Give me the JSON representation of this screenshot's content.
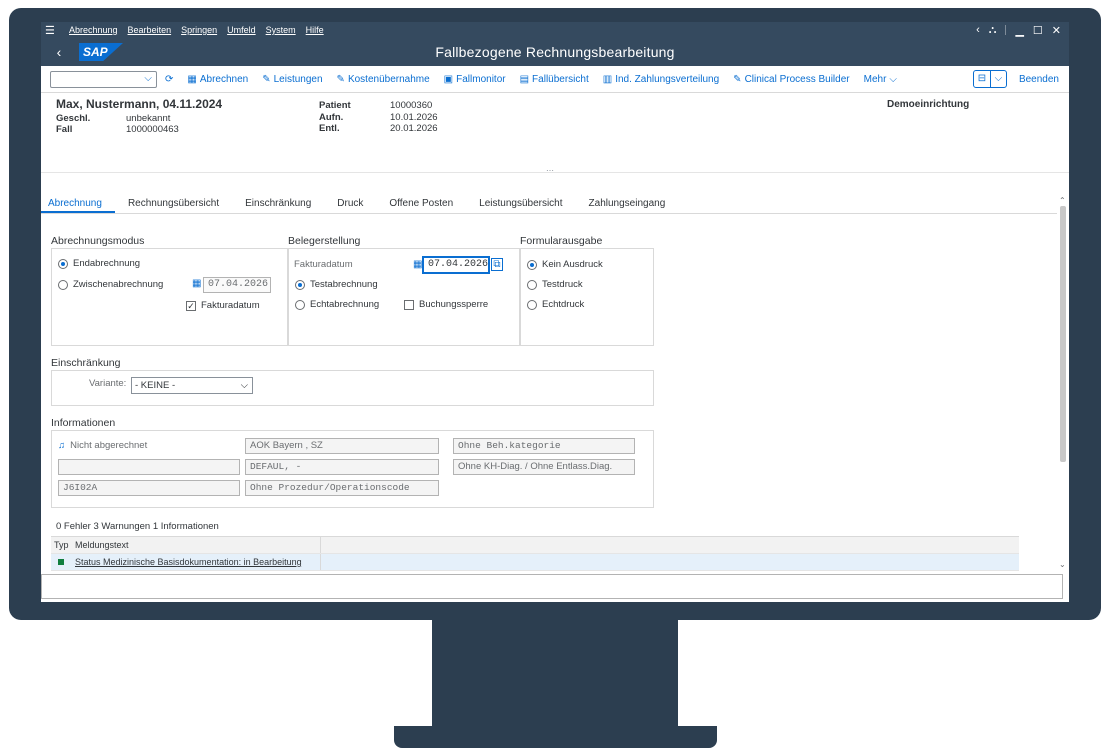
{
  "menu": [
    "Abrechnung",
    "Bearbeiten",
    "Springen",
    "Umfeld",
    "System",
    "Hilfe"
  ],
  "window_title": "Fallbezogene Rechnungsbearbeitung",
  "logo": "SAP",
  "toolbar": {
    "abrechnen": "Abrechnen",
    "leistungen": "Leistungen",
    "kostenuebernahme": "Kostenübernahme",
    "fallmonitor": "Fallmonitor",
    "falluebersicht": "Fallübersicht",
    "zahlungsverteilung": "Ind. Zahlungsverteilung",
    "clinical": "Clinical Process Builder",
    "mehr": "Mehr",
    "beenden": "Beenden"
  },
  "header": {
    "name": "Max, Nustermann, 04.11.2024",
    "geschl_label": "Geschl.",
    "geschl_value": "unbekannt",
    "fall_label": "Fall",
    "fall_value": "1000000463",
    "patient_label": "Patient",
    "patient_value": "10000360",
    "aufn_label": "Aufn.",
    "aufn_value": "10.01.2026",
    "entl_label": "Entl.",
    "entl_value": "20.01.2026",
    "einrichtung": "Demoeinrichtung"
  },
  "tabs": [
    "Abrechnung",
    "Rechnungsübersicht",
    "Einschränkung",
    "Druck",
    "Offene Posten",
    "Leistungsübersicht",
    "Zahlungseingang"
  ],
  "abrechnungsmodus": {
    "title": "Abrechnungsmodus",
    "end": "Endabrechnung",
    "zwischen": "Zwischenabrechnung",
    "datum": "07.04.2026",
    "fakturadatum": "Fakturadatum"
  },
  "belegerstellung": {
    "title": "Belegerstellung",
    "fakturadatum_label": "Fakturadatum",
    "datum": "07.04.2026",
    "test": "Testabrechnung",
    "echt": "Echtabrechnung",
    "sperre": "Buchungssperre"
  },
  "formularausgabe": {
    "title": "Formularausgabe",
    "kein": "Kein Ausdruck",
    "test": "Testdruck",
    "echt": "Echtdruck"
  },
  "einschraenkung": {
    "title": "Einschränkung",
    "variante_label": "Variante:",
    "variante_value": "- KEINE -"
  },
  "informationen": {
    "title": "Informationen",
    "status": "Nicht abgerechnet",
    "f1": "AOK Bayern , SZ",
    "f2": "Ohne Beh.kategorie",
    "f3": "",
    "f4": "DEFAUL, -",
    "f5": "Ohne KH-Diag. / Ohne Entlass.Diag.",
    "f6": "J6I02A",
    "f7": "Ohne Prozedur/Operationscode"
  },
  "messages": {
    "summary": "0 Fehler   3 Warnungen   1 Informationen",
    "col_typ": "Typ",
    "col_text": "Meldungstext",
    "row1": "Status Medizinische Basisdokumentation: in Bearbeitung"
  }
}
